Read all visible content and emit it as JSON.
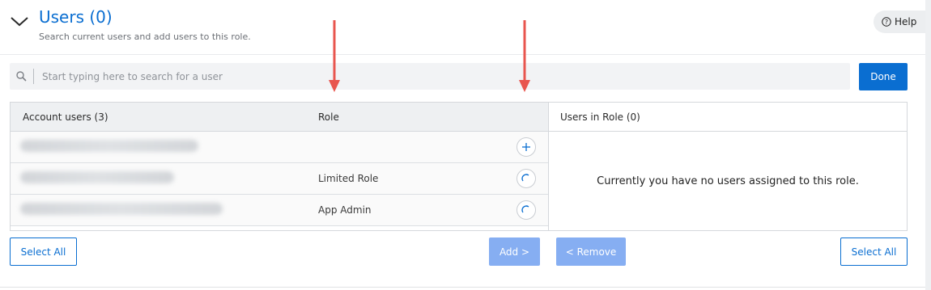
{
  "header": {
    "title": "Users (0)",
    "subtitle": "Search current users and add users to this role.",
    "help_label": "Help",
    "collapse_icon": "chevron-down-icon"
  },
  "search": {
    "placeholder": "Start typing here to search for a user",
    "value": "",
    "icon": "search-icon"
  },
  "done_label": "Done",
  "left_panel": {
    "accounts_header": "Account users (3)",
    "role_header": "Role",
    "rows": [
      {
        "email": "(blurred)",
        "role": "",
        "action": "add"
      },
      {
        "email": "(blurred)",
        "role": "Limited Role",
        "action": "loading"
      },
      {
        "email": "(blurred)",
        "role": "App Admin",
        "action": "loading"
      }
    ]
  },
  "right_panel": {
    "header": "Users in Role (0)",
    "empty_message": "Currently you have no users assigned to this role."
  },
  "footer": {
    "select_all_left": "Select All",
    "add_label": "Add >",
    "remove_label": "< Remove",
    "select_all_right": "Select All"
  },
  "colors": {
    "accent": "#0a6ed1",
    "disabled_button": "#86aef2",
    "annotation_arrow": "#e8554e"
  }
}
